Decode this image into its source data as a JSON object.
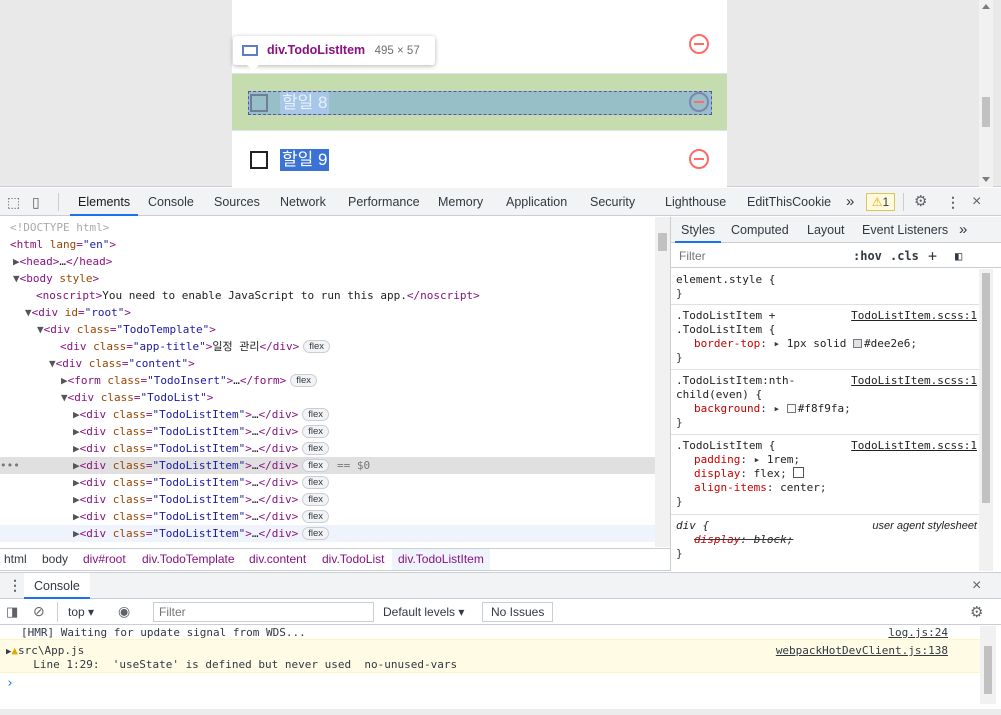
{
  "app": {
    "items": [
      {
        "text": "할일 8",
        "highlighted": true
      },
      {
        "text": "할일 9",
        "highlighted": false
      }
    ]
  },
  "tooltip": {
    "name": "div.TodoListItem",
    "size": "495 × 57"
  },
  "devtools": {
    "tabs": [
      "Elements",
      "Console",
      "Sources",
      "Network",
      "Performance",
      "Memory",
      "Application",
      "Security",
      "Lighthouse",
      "EditThisCookie"
    ],
    "active_tab": "Elements",
    "more": "»",
    "warning_count": "1",
    "close": "×"
  },
  "elements": {
    "doctype": "<!DOCTYPE html>",
    "noscript_text": "You need to enable JavaScript to run this app.",
    "app_title_text": "일정 관리",
    "flex_badge": "flex",
    "ellipsis": "…",
    "selected_marker": "== $0",
    "dots": "•••"
  },
  "breadcrumbs": [
    "html",
    "body",
    "div#root",
    "div.TodoTemplate",
    "div.content",
    "div.TodoList",
    "div.TodoListItem"
  ],
  "styles": {
    "tabs": [
      "Styles",
      "Computed",
      "Layout",
      "Event Listeners"
    ],
    "more": "»",
    "filter_placeholder": "Filter",
    "hov": ":hov",
    "cls": ".cls",
    "plus": "+",
    "rules": {
      "element_style": "element.style {",
      "close": "}",
      "r1_sel_a": ".TodoListItem +",
      "r1_sel_b": ".TodoListItem {",
      "r1_src": "TodoListItem.scss:1",
      "r1_pn": "border-top",
      "r1_pv": "1px solid",
      "r1_color": "#dee2e6",
      "r2_sel_a": ".TodoListItem:nth-",
      "r2_sel_b": "child(even) {",
      "r2_src": "TodoListItem.scss:1",
      "r2_pn": "background",
      "r2_color": "#f8f9fa",
      "r3_sel": ".TodoListItem {",
      "r3_src": "TodoListItem.scss:1",
      "r3_p1n": "padding",
      "r3_p1v": "1rem",
      "r3_p2n": "display",
      "r3_p2v": "flex",
      "r3_p3n": "align-items",
      "r3_p3v": "center",
      "r4_sel": "div {",
      "r4_src": "user agent stylesheet",
      "r4_pn": "display",
      "r4_pv": "block"
    }
  },
  "console": {
    "tab": "Console",
    "close": "×",
    "context": "top",
    "filter_placeholder": "Filter",
    "levels": "Default levels",
    "issues": "No Issues",
    "messages": {
      "m1": "[HMR] Waiting for update signal from WDS...",
      "m1_src": "log.js:24",
      "m2a": "src\\App.js",
      "m2b": "  Line 1:29:  'useState' is defined but never used  no-unused-vars",
      "m2_src": "webpackHotDevClient.js:138",
      "prompt": "›"
    }
  },
  "colors": {
    "accent": "#1a73e8",
    "remove": "#ff6b6b",
    "highlight_row": "#c5dcae"
  }
}
